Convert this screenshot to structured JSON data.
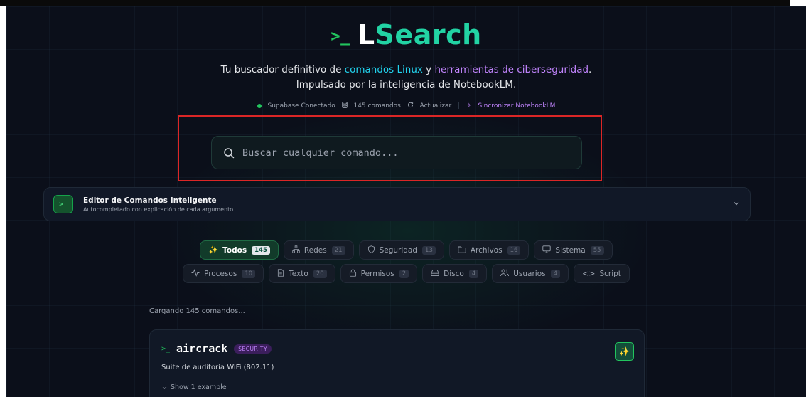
{
  "header": {
    "logo_prompt": ">_",
    "logo_L": "L",
    "logo_rest": "Search",
    "tagline_1a": "Tu buscador definitivo de ",
    "tagline_1b": "comandos Linux",
    "tagline_1c": " y ",
    "tagline_1d": "herramientas de ciberseguridad",
    "tagline_1e": ".",
    "tagline_2": "Impulsado por la inteligencia de NotebookLM."
  },
  "status": {
    "connected": "Supabase Conectado",
    "commands": "145 comandos",
    "refresh": "Actualizar",
    "sync": "Sincronizar NotebookLM"
  },
  "search": {
    "placeholder": "Buscar cualquier comando..."
  },
  "editor": {
    "badge": ">_",
    "title": "Editor de Comandos Inteligente",
    "subtitle": "Autocompletado con explicación de cada argumento"
  },
  "categories_row1": [
    {
      "label": "Todos",
      "count": "145"
    },
    {
      "label": "Redes",
      "count": "21"
    },
    {
      "label": "Seguridad",
      "count": "13"
    },
    {
      "label": "Archivos",
      "count": "16"
    },
    {
      "label": "Sistema",
      "count": "55"
    }
  ],
  "categories_row2": [
    {
      "label": "Procesos",
      "count": "10"
    },
    {
      "label": "Texto",
      "count": "20"
    },
    {
      "label": "Permisos",
      "count": "2"
    },
    {
      "label": "Disco",
      "count": "4"
    },
    {
      "label": "Usuarios",
      "count": "4"
    },
    {
      "label": "Script"
    }
  ],
  "loading": "Cargando 145 comandos...",
  "card": {
    "prompt": ">_",
    "name": "aircrack",
    "tag": "SECURITY",
    "description": "Suite de auditoría WiFi (802.11)",
    "example_toggle": "Show 1 example"
  },
  "colors": {
    "accent_green": "#22c55e",
    "accent_teal": "#22d3a4",
    "accent_cyan": "#22d3ee",
    "accent_purple": "#c084fc",
    "background": "#0b0f1a",
    "highlight_red": "#dc2626"
  }
}
